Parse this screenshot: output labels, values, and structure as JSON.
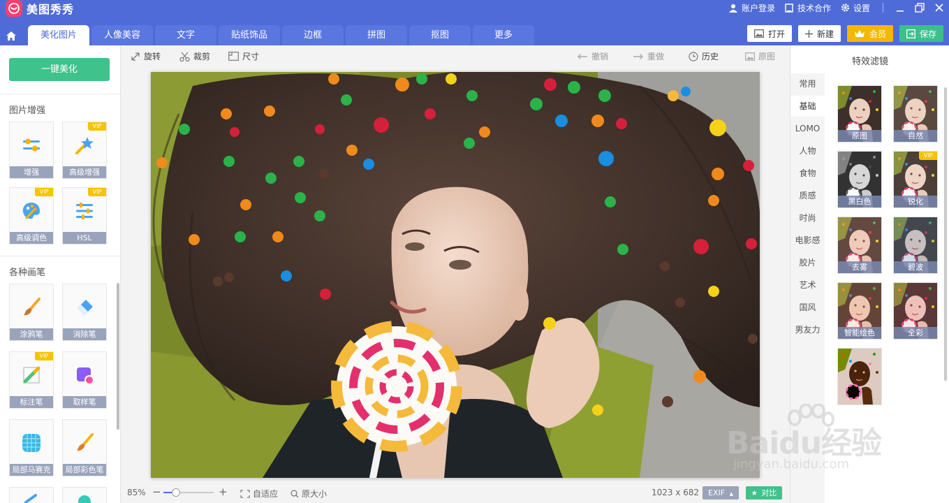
{
  "app": {
    "name": "美图秀秀",
    "top_links": [
      {
        "label": "账户登录",
        "icon": "user-icon"
      },
      {
        "label": "技术合作",
        "icon": "tablet-icon"
      },
      {
        "label": "设置",
        "icon": "gear-icon"
      }
    ]
  },
  "tabs": [
    {
      "label": "美化图片",
      "active": true
    },
    {
      "label": "人像美容"
    },
    {
      "label": "文字"
    },
    {
      "label": "贴纸饰品"
    },
    {
      "label": "边框"
    },
    {
      "label": "拼图"
    },
    {
      "label": "抠图"
    },
    {
      "label": "更多"
    }
  ],
  "actions": {
    "open": "打开",
    "new": "新建",
    "vip": "会员",
    "save": "保存"
  },
  "left": {
    "one_click": "一键美化",
    "section1_title": "图片增强",
    "section2_title": "各种画笔",
    "vip_badge": "VIP",
    "enhance_tools": [
      {
        "label": "增强",
        "icon": "sliders-icon"
      },
      {
        "label": "高级增强",
        "icon": "magic-wand-icon",
        "vip": true
      },
      {
        "label": "高级调色",
        "icon": "palette-icon",
        "vip": true
      },
      {
        "label": "HSL",
        "icon": "hsl-sliders-icon",
        "vip": true
      }
    ],
    "brush_tools": [
      {
        "label": "涂鸦笔",
        "icon": "paintbrush-icon"
      },
      {
        "label": "消除笔",
        "icon": "eraser-icon"
      },
      {
        "label": "标注笔",
        "icon": "marker-pen-icon",
        "vip": true
      },
      {
        "label": "取样笔",
        "icon": "sample-pen-icon"
      },
      {
        "label": "局部马赛克",
        "icon": "mosaic-icon"
      },
      {
        "label": "局部彩色笔",
        "icon": "color-brush-icon"
      }
    ]
  },
  "edit_toolbar": {
    "rotate": "旋转",
    "crop": "裁剪",
    "size": "尺寸",
    "undo": "撤销",
    "redo": "重做",
    "history": "历史",
    "original": "原图"
  },
  "status": {
    "zoom": "85%",
    "zoom_fraction": 0.25,
    "fit": "自适应",
    "actual_size": "原大小",
    "dimensions": "1023 x 682",
    "exif": "EXIF",
    "compare": "对比"
  },
  "right": {
    "title": "特效滤镜",
    "categories": [
      {
        "label": "常用"
      },
      {
        "label": "基础",
        "active": true
      },
      {
        "label": "LOMO"
      },
      {
        "label": "人物"
      },
      {
        "label": "食物"
      },
      {
        "label": "质感"
      },
      {
        "label": "时尚"
      },
      {
        "label": "电影感"
      },
      {
        "label": "胶片"
      },
      {
        "label": "艺术"
      },
      {
        "label": "国风"
      },
      {
        "label": "男友力"
      }
    ],
    "filters": [
      {
        "label": "原图"
      },
      {
        "label": "自然"
      },
      {
        "label": "黑白色"
      },
      {
        "label": "锐化",
        "vip": true
      },
      {
        "label": "去雾"
      },
      {
        "label": "碧波"
      },
      {
        "label": "智能绘色"
      },
      {
        "label": "全彩"
      },
      {
        "label": ""
      }
    ]
  },
  "watermark": {
    "text": "Baidu经验",
    "url": "jingyan.baidu.com"
  }
}
